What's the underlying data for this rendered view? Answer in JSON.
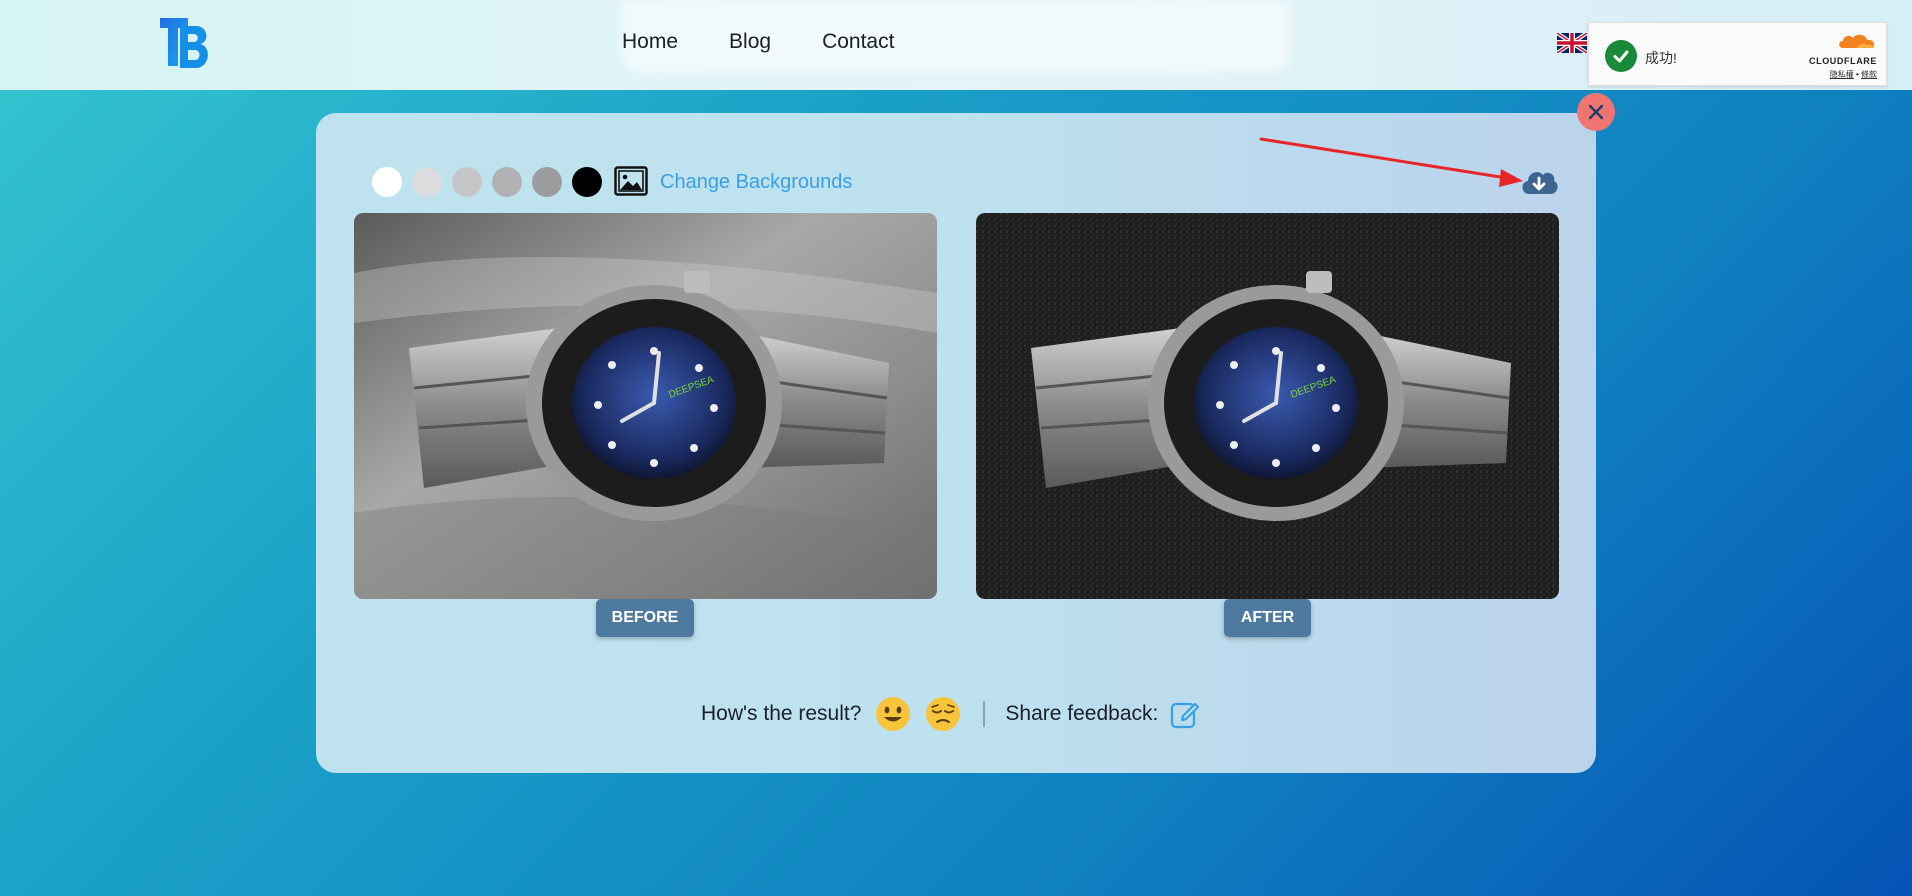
{
  "header": {
    "nav": [
      {
        "label": "Home"
      },
      {
        "label": "Blog"
      },
      {
        "label": "Contact"
      }
    ],
    "logo_icon": "tb-logo-icon",
    "language_icon": "uk-flag-icon"
  },
  "cloudflare": {
    "status": "成功!",
    "brand": "CLOUDFLARE",
    "privacy_link": "隐私權",
    "separator": "•",
    "terms_link": "條款",
    "check_icon": "check-circle-icon"
  },
  "editor": {
    "swatches": [
      "#ffffff",
      "#dcdcde",
      "#c6c6c8",
      "#b2b2b5",
      "#9c9c9f",
      "#000000"
    ],
    "change_backgrounds_label": "Change Backgrounds",
    "before_label": "BEFORE",
    "after_label": "AFTER",
    "download_icon": "cloud-download-icon",
    "close_icon": "close-icon"
  },
  "feedback": {
    "question": "How's the result?",
    "share_label": "Share feedback:",
    "happy_icon": "happy-emoji-icon",
    "sad_icon": "sad-emoji-icon",
    "edit_icon": "edit-icon"
  },
  "colors": {
    "accent_link": "#3b9fe5",
    "tag_bg": "#4f7a9f",
    "close_bg": "#f07472",
    "annotation_arrow": "#e8262a"
  }
}
